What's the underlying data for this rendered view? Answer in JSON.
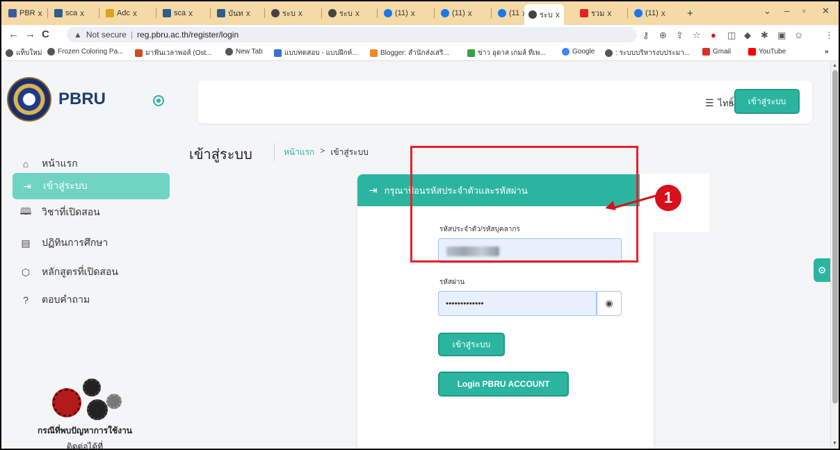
{
  "browser": {
    "tabs": [
      {
        "label": "PBR",
        "color": "#3b5b9c"
      },
      {
        "label": "sca",
        "color": "#2f5d8a"
      },
      {
        "label": "Adc",
        "color": "#e0a21d"
      },
      {
        "label": "sca",
        "color": "#2f5d8a"
      },
      {
        "label": "บันท",
        "color": "#2f5d8a"
      },
      {
        "label": "ระบ",
        "color": "#444444"
      },
      {
        "label": "ระบ",
        "color": "#444444"
      },
      {
        "label": "(11)",
        "color": "#1877f2"
      },
      {
        "label": "(11)",
        "color": "#1877f2"
      },
      {
        "label": "(11",
        "color": "#1877f2"
      },
      {
        "label": "ระบ",
        "color": "#444444",
        "active": true
      },
      {
        "label": "รวม",
        "color": "#e02424"
      },
      {
        "label": "(11)",
        "color": "#1877f2"
      }
    ],
    "new_tab": "+",
    "tab_close": "x",
    "not_secure": "Not secure",
    "url": "reg.pbru.ac.th/register/login",
    "bookmarks": [
      {
        "label": "แท็บใหม่",
        "color": "#555555"
      },
      {
        "label": "Frozen Coloring Pa...",
        "color": "#555555"
      },
      {
        "label": "มาฟันเวลาพอส์ (Ost...",
        "color": "#d64a1a"
      },
      {
        "label": "New Tab",
        "color": "#555555"
      },
      {
        "label": "แบบทดสอบ - แบบฝึกห์...",
        "color": "#3b6fd1"
      },
      {
        "label": "Blogger: สำนักส่งเสริ...",
        "color": "#f08a24"
      },
      {
        "label": "ข่าว อุดาส เกมส์ ทีเพ...",
        "color": "#3aa040"
      },
      {
        "label": "Google",
        "color": "#4285f4"
      },
      {
        "label": ": ระบบบริหารงบประมา...",
        "color": "#555555"
      },
      {
        "label": "Gmail",
        "color": "#d93025"
      },
      {
        "label": "YouTube",
        "color": "#ff0000"
      }
    ],
    "more_bookmarks": "»"
  },
  "sidebar": {
    "brand": "PBRU",
    "items": [
      {
        "label": "หน้าแรก",
        "icon": "home-icon"
      },
      {
        "label": "เข้าสู่ระบบ",
        "icon": "login-icon",
        "active": true
      },
      {
        "label": "วิชาที่เปิดสอน",
        "icon": "book-icon"
      },
      {
        "label": "ปฏิทินการศึกษา",
        "icon": "calendar-icon"
      },
      {
        "label": "หลักสูตรที่เปิดสอน",
        "icon": "package-icon"
      },
      {
        "label": "ตอบคำถาม",
        "icon": "question-icon"
      }
    ],
    "help_line1": "กรณีที่พบปัญหาการใช้งาน",
    "help_line2": "ติดต่อได้ที่"
  },
  "header": {
    "language": "ไทย",
    "login_button": "เข้าสู่ระบบ"
  },
  "page": {
    "title": "เข้าสู่ระบบ",
    "breadcrumb_home": "หน้าแรก",
    "breadcrumb_arrow": ">",
    "breadcrumb_current": "เข้าสู่ระบบ"
  },
  "login_card": {
    "heading": "กรุณาป้อนรหัสประจำตัวและรหัสผ่าน",
    "username_label": "รหัสประจำตัว/รหัสบุคลากร",
    "password_label": "รหัสผ่าน",
    "password_value": "•••••••••••••",
    "submit_label": "เข้าสู่ระบบ",
    "sso_label": "Login PBRU ACCOUNT"
  },
  "annotation": {
    "marker": "1",
    "color": "#d6111b"
  },
  "colors": {
    "accent": "#2bb5a0",
    "sidebar_active": "#6fd4c2",
    "tab_strip": "#f5d9a6"
  }
}
